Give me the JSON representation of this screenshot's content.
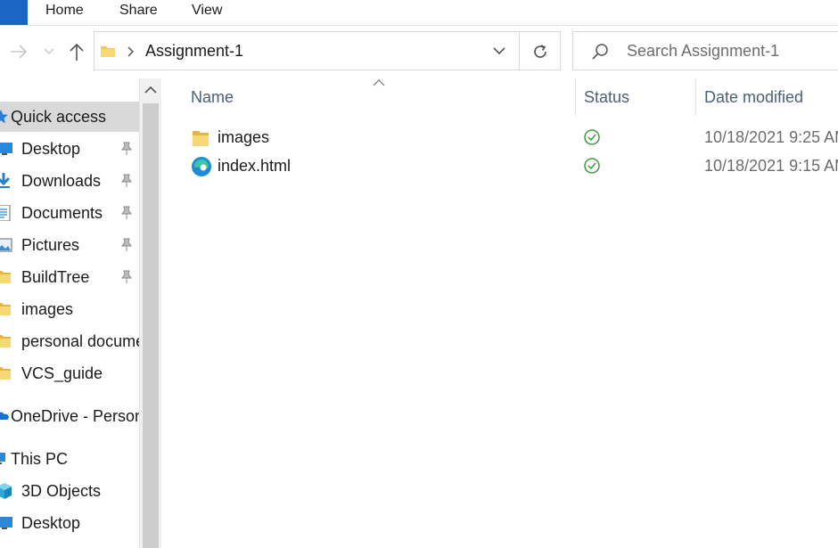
{
  "ribbon": {
    "tabs": [
      {
        "label": "Home"
      },
      {
        "label": "Share"
      },
      {
        "label": "View"
      }
    ],
    "accent": "#1a66c4"
  },
  "address": {
    "path": "Assignment-1",
    "search_placeholder": "Search Assignment-1"
  },
  "sidebar": {
    "items": [
      {
        "label": "Quick access",
        "icon": "star-icon",
        "selected": true,
        "root": true
      },
      {
        "label": "Desktop",
        "icon": "desktop-icon",
        "pinned": true
      },
      {
        "label": "Downloads",
        "icon": "download-icon",
        "pinned": true
      },
      {
        "label": "Documents",
        "icon": "document-icon",
        "pinned": true
      },
      {
        "label": "Pictures",
        "icon": "pictures-icon",
        "pinned": true
      },
      {
        "label": "BuildTree",
        "icon": "folder-icon",
        "pinned": true
      },
      {
        "label": "images",
        "icon": "folder-icon"
      },
      {
        "label": "personal documents",
        "icon": "folder-icon"
      },
      {
        "label": "VCS_guide",
        "icon": "folder-icon"
      },
      {
        "label": "OneDrive - Personal",
        "icon": "onedrive-icon",
        "root": true
      },
      {
        "label": "This PC",
        "icon": "pc-icon",
        "root": true
      },
      {
        "label": "3D Objects",
        "icon": "cube-icon"
      },
      {
        "label": "Desktop",
        "icon": "desktop-icon"
      }
    ]
  },
  "columns": {
    "name": "Name",
    "status": "Status",
    "date_modified": "Date modified"
  },
  "files": [
    {
      "name": "images",
      "icon": "folder-icon",
      "status": "synced-check-icon",
      "date": "10/18/2021 9:25 AM"
    },
    {
      "name": "index.html",
      "icon": "edge-browser-icon",
      "status": "synced-check-icon",
      "date": "10/18/2021 9:15 AM"
    }
  ],
  "colors": {
    "selected_bg": "#d9d9d9",
    "header_text": "#4c607a",
    "status_green": "#3c9a3f",
    "folder_yellow": "#f2c94c"
  }
}
